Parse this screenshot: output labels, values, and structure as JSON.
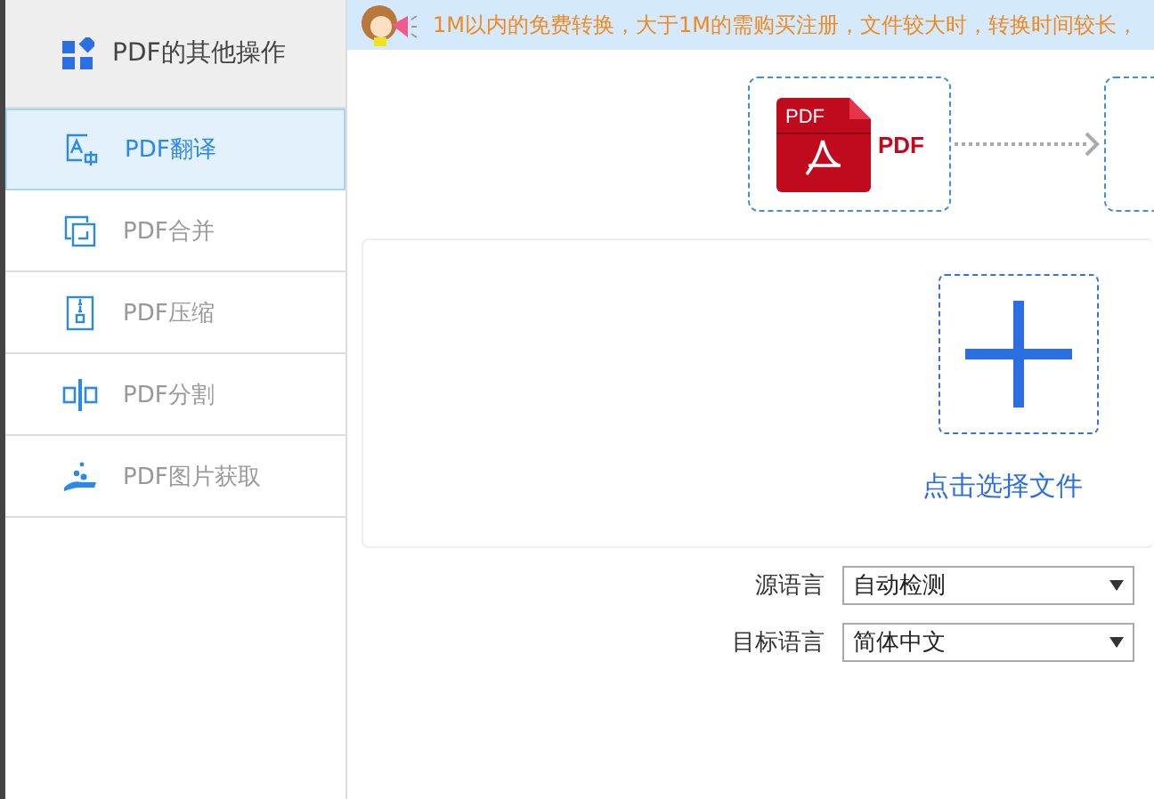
{
  "sidebar": {
    "title": "PDF的其他操作",
    "items": [
      {
        "label": "PDF翻译",
        "kind": "translate",
        "selected": true
      },
      {
        "label": "PDF合并",
        "kind": "merge",
        "selected": false
      },
      {
        "label": "PDF压缩",
        "kind": "compress",
        "selected": false
      },
      {
        "label": "PDF分割",
        "kind": "split",
        "selected": false
      },
      {
        "label": "PDF图片获取",
        "kind": "image",
        "selected": false
      }
    ]
  },
  "notice": "1M以内的免费转换，大于1M的需购买注册，文件较大时，转换时间较长，",
  "conversion": {
    "icon_text": "PDF",
    "source_label": "PDF"
  },
  "upload": {
    "label": "点击选择文件"
  },
  "options": [
    {
      "label": "源语言",
      "value": "自动检测"
    },
    {
      "label": "目标语言",
      "value": "简体中文"
    }
  ]
}
